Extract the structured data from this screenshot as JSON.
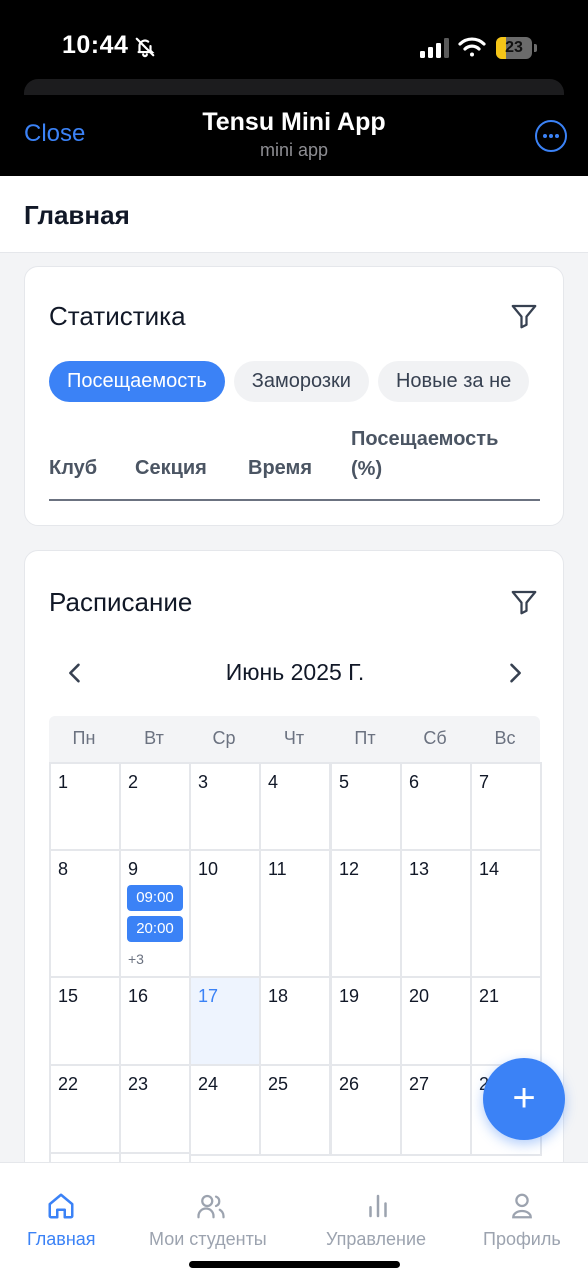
{
  "status_bar": {
    "time": "10:44",
    "battery": "23"
  },
  "telegram_header": {
    "close_label": "Close",
    "title": "Tensu Mini App",
    "subtitle": "mini app"
  },
  "page": {
    "title": "Главная"
  },
  "stats": {
    "title": "Статистика",
    "chips": [
      "Посещаемость",
      "Заморозки",
      "Новые за не"
    ],
    "columns": [
      "Клуб",
      "Секция",
      "Время",
      "Посещаемость (%)"
    ]
  },
  "schedule": {
    "title": "Расписание",
    "month_label": "Июнь 2025 Г.",
    "weekdays": [
      "Пн",
      "Вт",
      "Ср",
      "Чт",
      "Пт",
      "Сб",
      "Вс"
    ],
    "weeks": [
      [
        "1",
        "2",
        "3",
        "4",
        "5",
        "6",
        "7"
      ],
      [
        "8",
        "9",
        "10",
        "11",
        "12",
        "13",
        "14"
      ],
      [
        "15",
        "16",
        "17",
        "18",
        "19",
        "20",
        "21"
      ],
      [
        "22",
        "23",
        "24",
        "25",
        "26",
        "27",
        "28"
      ]
    ],
    "today": "17",
    "events_day": "9",
    "events": [
      "09:00",
      "20:00"
    ],
    "more_events": "+3"
  },
  "fab": {
    "label": "+"
  },
  "bottom_nav": {
    "items": [
      {
        "label": "Главная",
        "icon": "home-icon",
        "active": true
      },
      {
        "label": "Мои студенты",
        "icon": "users-icon",
        "active": false
      },
      {
        "label": "Управление",
        "icon": "bar-chart-icon",
        "active": false
      },
      {
        "label": "Профиль",
        "icon": "profile-icon",
        "active": false
      }
    ]
  },
  "colors": {
    "accent": "#3b82f6",
    "today_bg": "#eef4fe",
    "chip_bg": "#f1f2f4"
  }
}
